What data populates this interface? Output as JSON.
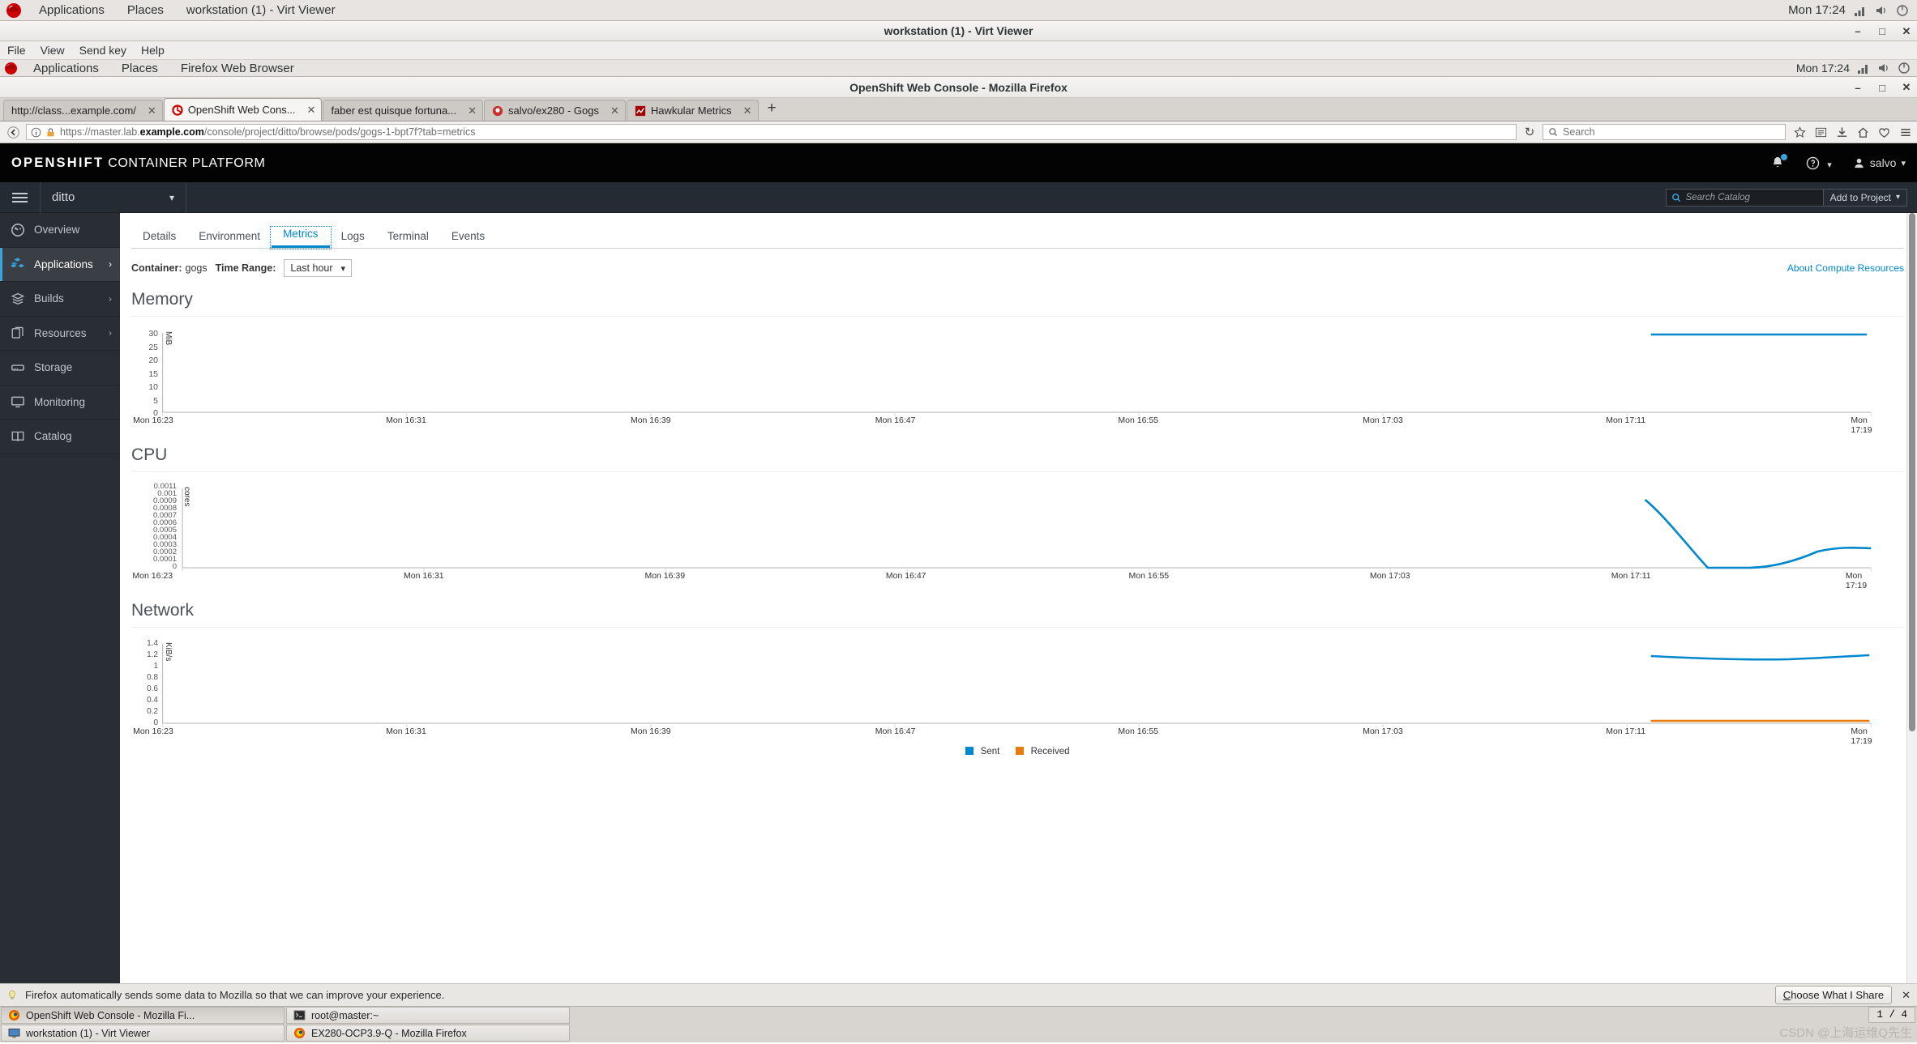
{
  "gnome_outer": {
    "apps": "Applications",
    "places": "Places",
    "window_title": "workstation (1) - Virt Viewer",
    "clock": "Mon 17:24"
  },
  "virt_viewer": {
    "title": "workstation (1) - Virt Viewer",
    "menu": [
      "File",
      "View",
      "Send key",
      "Help"
    ],
    "minimize": "–",
    "maximize": "□",
    "close": "✕"
  },
  "gnome_guest": {
    "apps": "Applications",
    "places": "Places",
    "window_title": "Firefox Web Browser",
    "clock": "Mon 17:24"
  },
  "firefox": {
    "title": "OpenShift Web Console - Mozilla Firefox",
    "minimize": "–",
    "maximize": "□",
    "close": "✕",
    "tabs": [
      {
        "label": "http://class...example.com/",
        "favicon": "none",
        "active": false,
        "close": "✕"
      },
      {
        "label": "OpenShift Web Cons...",
        "favicon": "openshift-icon",
        "active": true,
        "close": "✕"
      },
      {
        "label": "faber est quisque fortuna...",
        "favicon": "none",
        "active": false,
        "close": "✕"
      },
      {
        "label": "salvo/ex280 - Gogs",
        "favicon": "gogs-icon",
        "active": false,
        "close": "✕"
      },
      {
        "label": "Hawkular Metrics",
        "favicon": "hawkular-icon",
        "active": false,
        "close": "✕"
      }
    ],
    "new_tab": "+",
    "url": {
      "scheme": "https://master.lab.",
      "domain": "example.com",
      "path": "/console/project/ditto/browse/pods/gogs-1-bpt7f?tab=metrics"
    },
    "search_placeholder": "Search",
    "back": "←",
    "reload": "↻",
    "notification": "Firefox automatically sends some data to Mozilla so that we can improve your experience.",
    "share_button": "Choose What I Share",
    "notify_close": "✕"
  },
  "openshift": {
    "brand_bold": "OPENSHIFT",
    "brand_rest": "CONTAINER PLATFORM",
    "user": "salvo",
    "help_icon": "question-circle-icon",
    "bell_icon": "bell-icon",
    "project": "ditto",
    "catalog_search_placeholder": "Search Catalog",
    "add_to_project": "Add to Project",
    "sidebar": [
      {
        "label": "Overview",
        "icon": "dashboard-icon",
        "active": false,
        "chevron": ""
      },
      {
        "label": "Applications",
        "icon": "cubes-icon",
        "active": true,
        "chevron": "›"
      },
      {
        "label": "Builds",
        "icon": "layers-icon",
        "active": false,
        "chevron": "›"
      },
      {
        "label": "Resources",
        "icon": "files-icon",
        "active": false,
        "chevron": "›"
      },
      {
        "label": "Storage",
        "icon": "database-icon",
        "active": false,
        "chevron": ""
      },
      {
        "label": "Monitoring",
        "icon": "monitor-icon",
        "active": false,
        "chevron": ""
      },
      {
        "label": "Catalog",
        "icon": "book-icon",
        "active": false,
        "chevron": ""
      }
    ],
    "tabs": [
      {
        "label": "Details",
        "active": false
      },
      {
        "label": "Environment",
        "active": false
      },
      {
        "label": "Metrics",
        "active": true
      },
      {
        "label": "Logs",
        "active": false
      },
      {
        "label": "Terminal",
        "active": false
      },
      {
        "label": "Events",
        "active": false
      }
    ],
    "container_label": "Container:",
    "container_value": "gogs",
    "time_range_label": "Time Range:",
    "time_range_value": "Last hour",
    "time_range_caret": "⌄",
    "about_link": "About Compute Resources"
  },
  "chart_data": [
    {
      "type": "line",
      "title": "Memory",
      "ylabel": "MiB",
      "xlabel": "",
      "ylim": [
        0,
        32
      ],
      "yticks": [
        0,
        5,
        10,
        15,
        20,
        25,
        30
      ],
      "xticks": [
        "Mon 16:23",
        "Mon 16:31",
        "Mon 16:39",
        "Mon 16:47",
        "Mon 16:55",
        "Mon 17:03",
        "Mon 17:11",
        "Mon 17:19"
      ],
      "grid": false,
      "legend": null,
      "series": [
        {
          "name": "Memory",
          "color": "#0088ce",
          "x": [
            "Mon 17:11",
            "Mon 17:13",
            "Mon 17:15",
            "Mon 17:17",
            "Mon 17:19",
            "Mon 17:21"
          ],
          "values": [
            31.5,
            31.5,
            31.5,
            31.5,
            31.5,
            31.5
          ]
        }
      ]
    },
    {
      "type": "line",
      "title": "CPU",
      "ylabel": "cores",
      "xlabel": "",
      "ylim": [
        0,
        0.0011
      ],
      "yticks": [
        0,
        0.0001,
        0.0002,
        0.0003,
        0.0004,
        0.0005,
        0.0006,
        0.0007,
        0.0008,
        0.0009,
        0.001,
        0.0011
      ],
      "xticks": [
        "Mon 16:23",
        "Mon 16:31",
        "Mon 16:39",
        "Mon 16:47",
        "Mon 16:55",
        "Mon 17:03",
        "Mon 17:11",
        "Mon 17:19"
      ],
      "grid": false,
      "legend": null,
      "series": [
        {
          "name": "CPU",
          "color": "#0088ce",
          "x": [
            "Mon 17:12",
            "Mon 17:14",
            "Mon 17:15",
            "Mon 17:17",
            "Mon 17:18",
            "Mon 17:19",
            "Mon 17:20",
            "Mon 17:21"
          ],
          "values": [
            0.00095,
            0.0004,
            0.0,
            0.0,
            0.00015,
            0.00028,
            0.0003,
            0.0003
          ]
        }
      ]
    },
    {
      "type": "line",
      "title": "Network",
      "ylabel": "KiB/s",
      "xlabel": "",
      "ylim": [
        0,
        1.5
      ],
      "yticks": [
        0,
        0.2,
        0.4,
        0.6,
        0.8,
        1,
        1.2,
        1.4
      ],
      "xticks": [
        "Mon 16:23",
        "Mon 16:31",
        "Mon 16:39",
        "Mon 16:47",
        "Mon 16:55",
        "Mon 17:03",
        "Mon 17:11",
        "Mon 17:19"
      ],
      "grid": false,
      "legend": {
        "position": "bottom",
        "entries": [
          {
            "label": "Sent",
            "color": "#0088ce"
          },
          {
            "label": "Received",
            "color": "#ec7a08"
          }
        ]
      },
      "series": [
        {
          "name": "Sent",
          "color": "#0088ce",
          "x": [
            "Mon 17:11",
            "Mon 17:13",
            "Mon 17:15",
            "Mon 17:17",
            "Mon 17:19",
            "Mon 17:21"
          ],
          "values": [
            1.22,
            1.2,
            1.17,
            1.18,
            1.21,
            1.22
          ]
        },
        {
          "name": "Received",
          "color": "#ec7a08",
          "x": [
            "Mon 17:11",
            "Mon 17:13",
            "Mon 17:15",
            "Mon 17:17",
            "Mon 17:19",
            "Mon 17:21"
          ],
          "values": [
            0.015,
            0.015,
            0.015,
            0.015,
            0.015,
            0.015
          ]
        }
      ]
    }
  ],
  "taskbar": {
    "buttons": [
      {
        "label": "OpenShift Web Console - Mozilla Fi...",
        "icon": "firefox-icon",
        "pressed": true
      },
      {
        "label": "root@master:~",
        "icon": "terminal-icon",
        "pressed": false
      },
      {
        "label": "workstation (1) - Virt Viewer",
        "icon": "monitor-icon",
        "pressed": false
      },
      {
        "label": "EX280-OCP3.9-Q - Mozilla Firefox",
        "icon": "firefox-icon",
        "pressed": false
      }
    ],
    "pager": "1 / 4",
    "watermark": "CSDN @上海运维Q先生"
  }
}
